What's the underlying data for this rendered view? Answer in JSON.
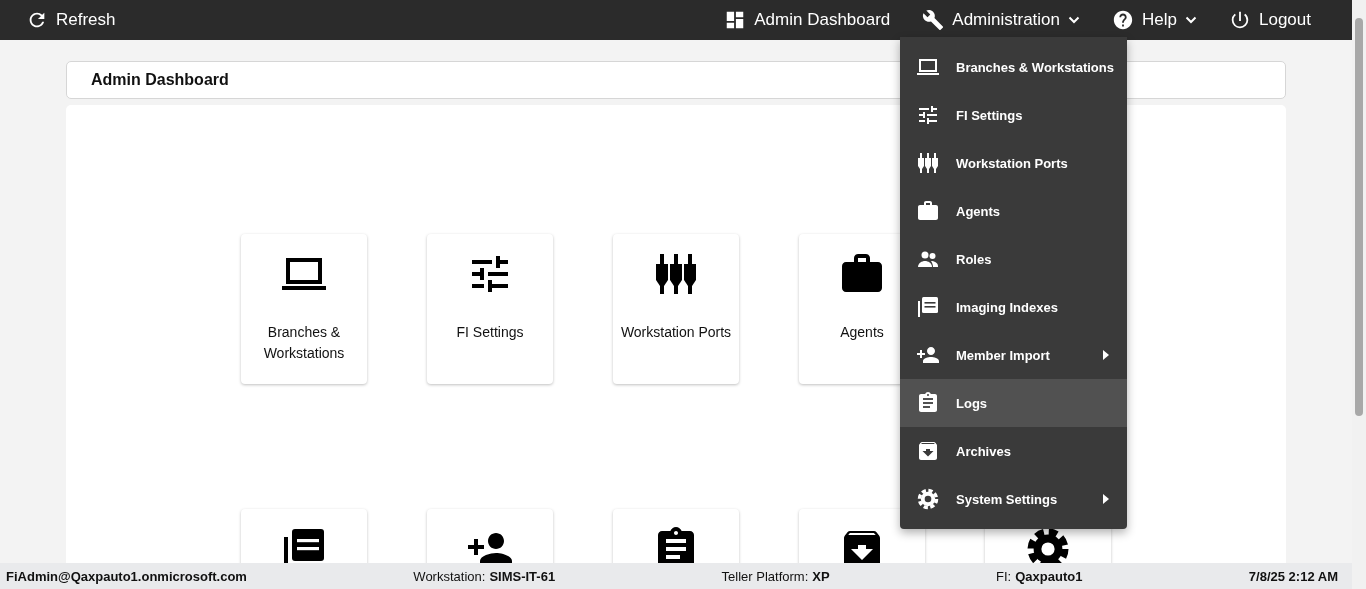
{
  "top_bar": {
    "refresh": {
      "label": "Refresh"
    },
    "nav": [
      {
        "kind": "dashboard",
        "label": "Admin Dashboard",
        "dropdown": false
      },
      {
        "kind": "wrench",
        "label": "Administration",
        "dropdown": true
      },
      {
        "kind": "help",
        "label": "Help",
        "dropdown": true
      },
      {
        "kind": "power",
        "label": "Logout",
        "dropdown": false
      }
    ]
  },
  "page_title": "Admin Dashboard",
  "tile_rows": [
    [
      {
        "kind": "laptop",
        "label": "Branches & Workstations"
      },
      {
        "kind": "sliders",
        "label": "FI Settings"
      },
      {
        "kind": "ports",
        "label": "Workstation Ports"
      },
      {
        "kind": "briefcase",
        "label": "Agents"
      }
    ],
    [
      {
        "kind": "pdf"
      },
      {
        "kind": "person-add"
      },
      {
        "kind": "clipboard"
      },
      {
        "kind": "archive"
      },
      {
        "kind": "gear"
      }
    ]
  ],
  "admin_menu": [
    {
      "kind": "laptop",
      "label": "Branches & Workstations",
      "submenu": false,
      "highlighted": false
    },
    {
      "kind": "sliders",
      "label": "FI Settings",
      "submenu": false,
      "highlighted": false
    },
    {
      "kind": "ports",
      "label": "Workstation Ports",
      "submenu": false,
      "highlighted": false
    },
    {
      "kind": "briefcase",
      "label": "Agents",
      "submenu": false,
      "highlighted": false
    },
    {
      "kind": "people",
      "label": "Roles",
      "submenu": false,
      "highlighted": false
    },
    {
      "kind": "pdf",
      "label": "Imaging Indexes",
      "submenu": false,
      "highlighted": false
    },
    {
      "kind": "person-add",
      "label": "Member Import",
      "submenu": true,
      "highlighted": false
    },
    {
      "kind": "clipboard",
      "label": "Logs",
      "submenu": false,
      "highlighted": true
    },
    {
      "kind": "archive",
      "label": "Archives",
      "submenu": false,
      "highlighted": false
    },
    {
      "kind": "gear",
      "label": "System Settings",
      "submenu": true,
      "highlighted": false
    }
  ],
  "status_bar": [
    {
      "value": "FiAdmin@Qaxpauto1.onmicrosoft.com"
    },
    {
      "label": "Workstation:",
      "value": "SIMS-IT-61"
    },
    {
      "label": "Teller Platform:",
      "value": "XP"
    },
    {
      "label": "FI:",
      "value": "Qaxpauto1"
    },
    {
      "value": "7/8/25 2:12 AM"
    }
  ]
}
